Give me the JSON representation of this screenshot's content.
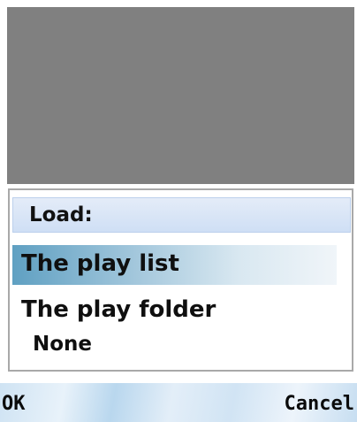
{
  "dialog": {
    "title": "Load:",
    "options": [
      {
        "label": "The play list",
        "selected": true
      },
      {
        "label": "The play folder",
        "selected": false
      },
      {
        "label": "None",
        "selected": false
      }
    ]
  },
  "softkeys": {
    "left": "OK",
    "right": "Cancel"
  },
  "colors": {
    "preview_background": "#808080",
    "title_bar": "#d6e3f6",
    "selection_highlight": "#5fa0c2",
    "softkey_bar": "#d1e4f4"
  }
}
